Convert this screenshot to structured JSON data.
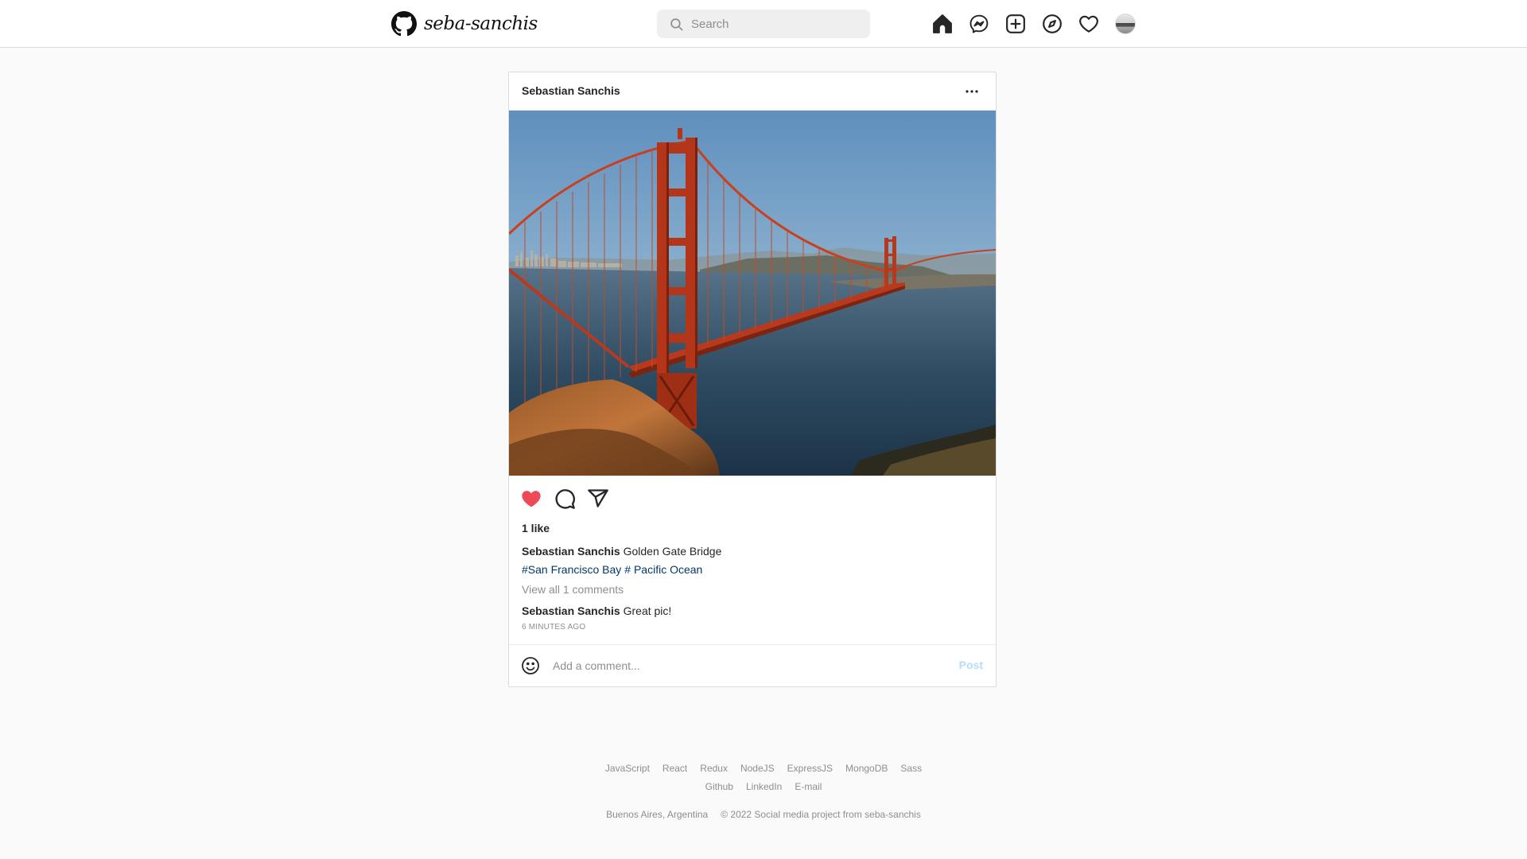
{
  "header": {
    "brand_name": "seba-sanchis",
    "logo_icon": "github-icon",
    "search": {
      "placeholder": "Search",
      "value": ""
    },
    "nav_icons": [
      "home-icon",
      "messenger-icon",
      "new-post-icon",
      "explore-icon",
      "activity-heart-icon",
      "profile-avatar"
    ]
  },
  "post": {
    "author": "Sebastian Sanchis",
    "image_alt": "Golden Gate Bridge",
    "likes": "1 like",
    "liked": true,
    "caption": {
      "author": "Sebastian Sanchis",
      "text": "Golden Gate Bridge"
    },
    "tags": [
      "#San Francisco Bay",
      "# Pacific Ocean"
    ],
    "view_all": "View all 1 comments",
    "comments": [
      {
        "author": "Sebastian Sanchis",
        "text": "Great pic!"
      }
    ],
    "time": "6 MINUTES AGO",
    "comment_box": {
      "placeholder": "Add a comment...",
      "post_label": "Post"
    }
  },
  "footer": {
    "links_row1": [
      "JavaScript",
      "React",
      "Redux",
      "NodeJS",
      "ExpressJS",
      "MongoDB",
      "Sass"
    ],
    "links_row2": [
      "Github",
      "LinkedIn",
      "E-mail"
    ],
    "location": "Buenos Aires, Argentina",
    "copyright": "© 2022 Social media project from seba-sanchis"
  },
  "colors": {
    "like_red": "#ed4956",
    "link_blue": "#00376b",
    "post_button_disabled": "#b2dffc",
    "muted_text": "#8e8e8e",
    "border": "#dbdbdb"
  }
}
